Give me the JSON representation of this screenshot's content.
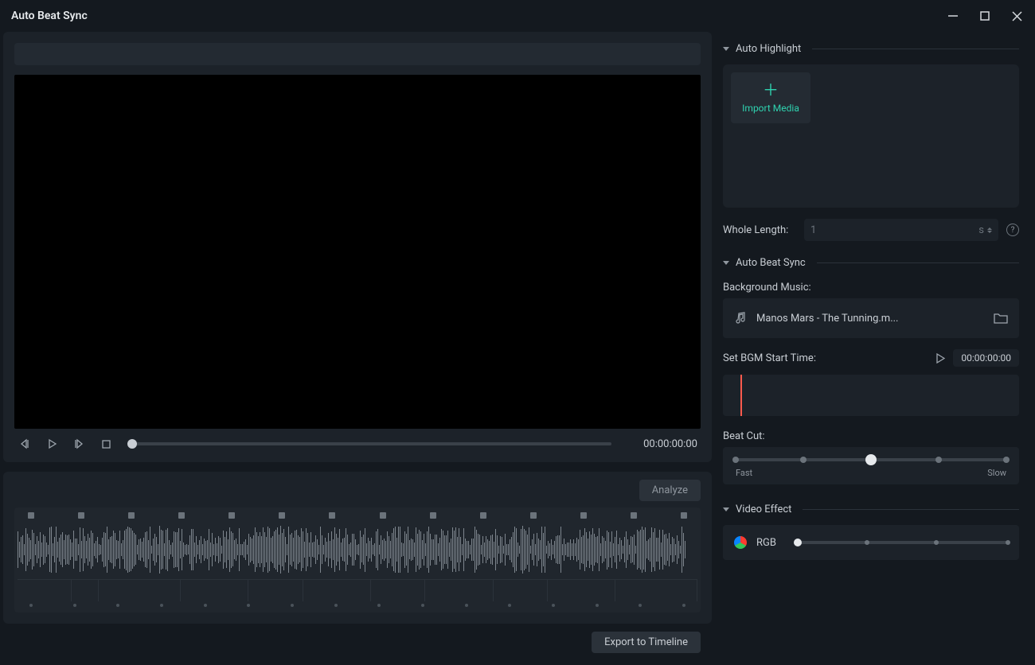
{
  "window": {
    "title": "Auto Beat Sync"
  },
  "preview": {
    "timecode": "00:00:00:00"
  },
  "analyze": {
    "button": "Analyze"
  },
  "footer": {
    "export": "Export to Timeline"
  },
  "sidebar": {
    "sections": {
      "autoHighlight": "Auto Highlight",
      "autoBeatSync": "Auto Beat Sync",
      "videoEffect": "Video Effect"
    },
    "importMedia": "Import Media",
    "wholeLength": {
      "label": "Whole Length:",
      "value": "1",
      "unit": "s"
    },
    "bgm": {
      "label": "Background Music:",
      "filename": "Manos Mars - The Tunning.m...",
      "startLabel": "Set BGM Start Time:",
      "startTime": "00:00:00:00"
    },
    "beatCut": {
      "label": "Beat Cut:",
      "fast": "Fast",
      "slow": "Slow"
    },
    "effect": {
      "name": "RGB"
    }
  }
}
